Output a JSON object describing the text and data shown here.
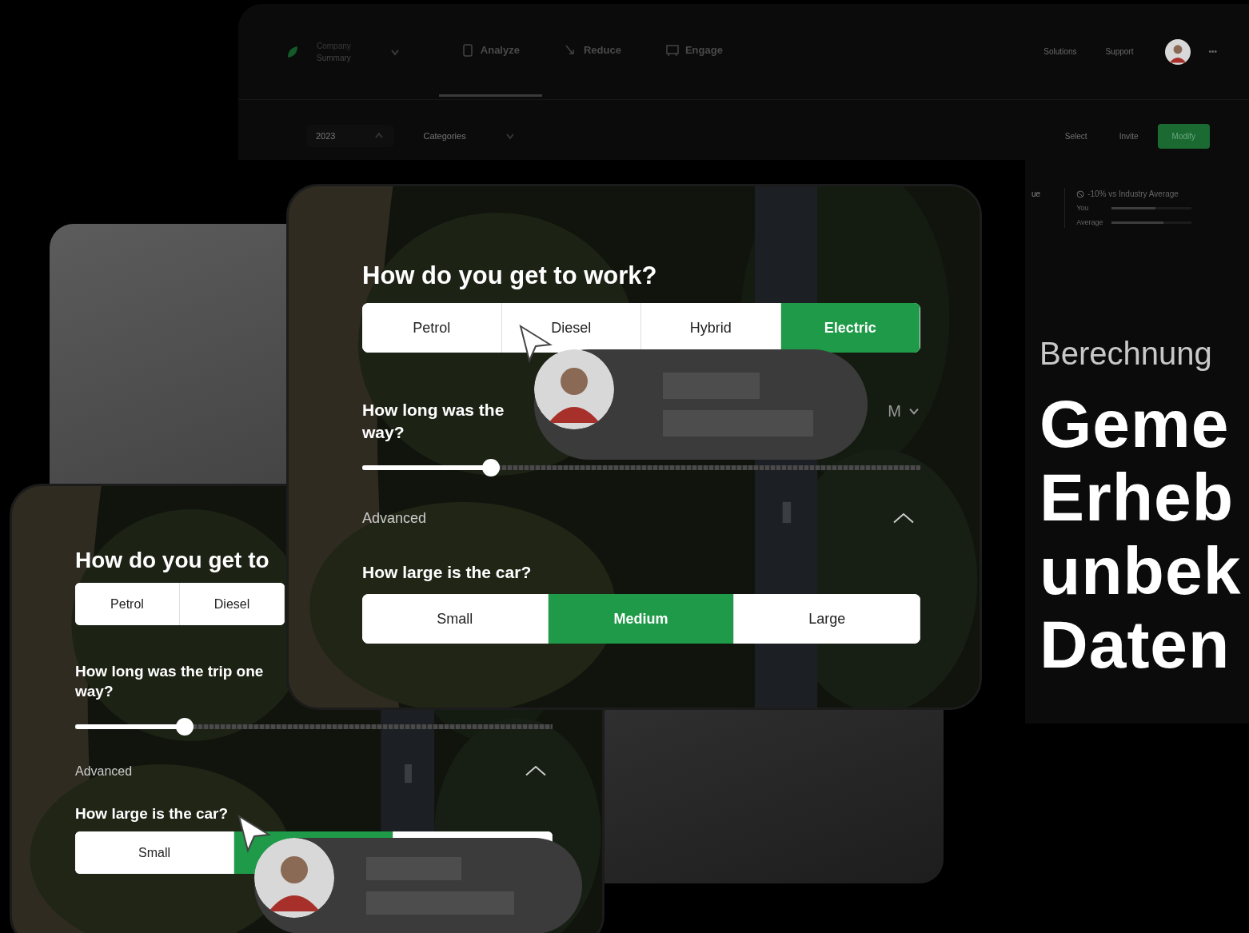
{
  "dashboard": {
    "switcher": {
      "label": "Company",
      "value": "Summary"
    },
    "tabs": [
      {
        "label": "Analyze",
        "selected": true
      },
      {
        "label": "Reduce",
        "selected": false
      },
      {
        "label": "Engage",
        "selected": false
      }
    ],
    "nav_links": [
      "Solutions",
      "Support"
    ],
    "more": "•••",
    "filters": [
      "2023",
      "Categories"
    ],
    "actions": [
      {
        "label": "Select",
        "primary": false
      },
      {
        "label": "Invite",
        "primary": false
      },
      {
        "label": "Modify",
        "primary": true
      }
    ],
    "column_fragment": "ue",
    "comparison": {
      "title": "-10% vs Industry Average",
      "bars": [
        {
          "label": "You",
          "level": 0.55
        },
        {
          "label": "Average",
          "level": 0.65
        }
      ]
    }
  },
  "phone": {
    "sections": [
      {
        "kind": "choice",
        "question": "How do you get to",
        "options": [
          {
            "label": "Petrol",
            "selected": false
          },
          {
            "label": "Diesel",
            "selected": false
          }
        ]
      },
      {
        "kind": "slider",
        "question": "How long was the trip one way?",
        "level": 0.23
      },
      {
        "kind": "toggle",
        "label": "Advanced",
        "expanded": true
      },
      {
        "kind": "choice",
        "question": "How large is the car?",
        "options": [
          {
            "label": "Small",
            "selected": false
          },
          {
            "selected": true
          },
          {
            "selected": false
          }
        ]
      }
    ]
  },
  "tablet": {
    "sections": [
      {
        "kind": "choice",
        "question": "How do you get to work?",
        "options": [
          {
            "label": "Petrol",
            "selected": false
          },
          {
            "label": "Diesel",
            "selected": false
          },
          {
            "label": "Hybrid",
            "selected": false
          },
          {
            "label": "Electric",
            "selected": true
          }
        ]
      },
      {
        "kind": "slider",
        "question": "How long was the way?",
        "unit": "M",
        "level": 0.23
      },
      {
        "kind": "toggle",
        "label": "Advanced",
        "expanded": true
      },
      {
        "kind": "choice",
        "question": "How large is the car?",
        "options": [
          {
            "label": "Small",
            "selected": false
          },
          {
            "label": "Medium",
            "selected": true
          },
          {
            "label": "Large",
            "selected": false
          }
        ]
      }
    ]
  },
  "hero": {
    "eyebrow": "Berechnung",
    "heading_lines": [
      "Geme",
      "Erheb",
      "unbek",
      "Daten"
    ]
  }
}
